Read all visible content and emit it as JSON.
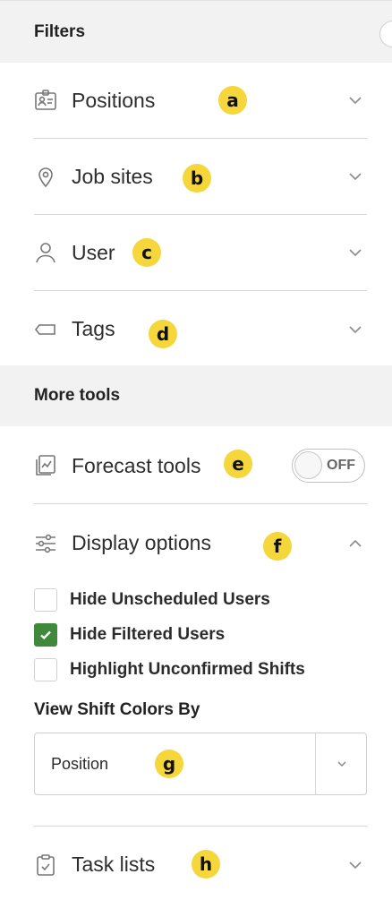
{
  "filters": {
    "header": "Filters",
    "items": [
      {
        "label": "Positions",
        "icon": "id-card-icon",
        "badge": "a"
      },
      {
        "label": "Job sites",
        "icon": "map-pin-icon",
        "badge": "b"
      },
      {
        "label": "User",
        "icon": "user-icon",
        "badge": "c"
      },
      {
        "label": "Tags",
        "icon": "tag-icon",
        "badge": "d"
      }
    ]
  },
  "more_tools": {
    "header": "More tools",
    "forecast": {
      "label": "Forecast tools",
      "icon": "forecast-icon",
      "badge": "e",
      "toggle_text": "OFF"
    },
    "display": {
      "label": "Display options",
      "icon": "sliders-icon",
      "badge": "f",
      "options": [
        {
          "label": "Hide Unscheduled Users",
          "checked": false
        },
        {
          "label": "Hide Filtered Users",
          "checked": true
        },
        {
          "label": "Highlight Unconfirmed Shifts",
          "checked": false
        }
      ],
      "view_colors_label": "View Shift Colors By",
      "select_value": "Position",
      "select_badge": "g"
    },
    "tasks": {
      "label": "Task lists",
      "icon": "clipboard-icon",
      "badge": "h"
    }
  },
  "colors": {
    "badge": "#f5d63b",
    "checked": "#3f8a3a",
    "header_bg": "#f2f2f2"
  }
}
